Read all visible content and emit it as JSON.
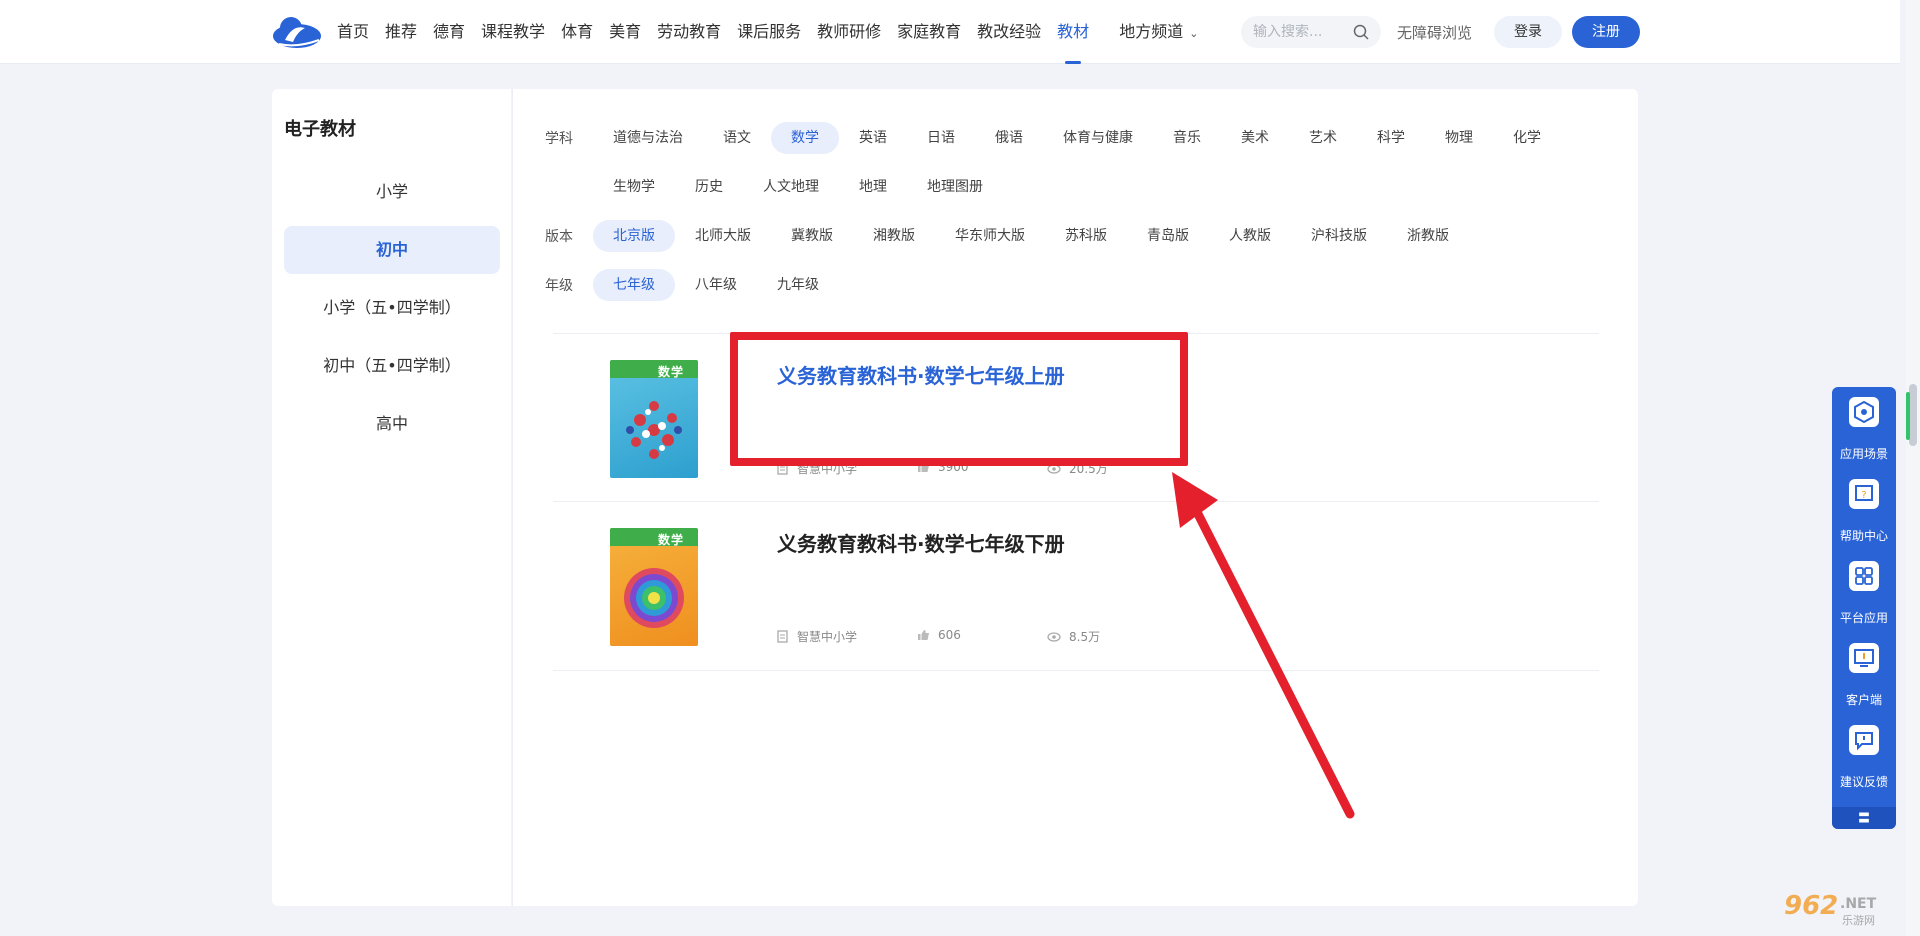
{
  "nav": {
    "items": [
      "首页",
      "推荐",
      "德育",
      "课程教学",
      "体育",
      "美育",
      "劳动教育",
      "课后服务",
      "教师研修",
      "家庭教育",
      "教改经验",
      "教材",
      "地方频道"
    ],
    "active_index": 11,
    "search_placeholder": "输入搜索...",
    "accessible_label": "无障碍浏览",
    "login_label": "登录",
    "register_label": "注册",
    "accent": "#2a63d6"
  },
  "sidebar": {
    "title": "电子教材",
    "items": [
      "小学",
      "初中",
      "小学（五•四学制）",
      "初中（五•四学制）",
      "高中"
    ],
    "active_index": 1
  },
  "filters": {
    "subject": {
      "label": "学科",
      "row1": [
        "道德与法治",
        "语文",
        "数学",
        "英语",
        "日语",
        "俄语",
        "体育与健康",
        "音乐",
        "美术",
        "艺术",
        "科学",
        "物理",
        "化学"
      ],
      "row2": [
        "生物学",
        "历史",
        "人文地理",
        "地理",
        "地理图册"
      ],
      "active": "数学"
    },
    "edition": {
      "label": "版本",
      "items": [
        "北京版",
        "北师大版",
        "冀教版",
        "湘教版",
        "华东师大版",
        "苏科版",
        "青岛版",
        "人教版",
        "沪科技版",
        "浙教版"
      ],
      "active": "北京版"
    },
    "grade": {
      "label": "年级",
      "items": [
        "七年级",
        "八年级",
        "九年级"
      ],
      "active": "七年级"
    }
  },
  "books": [
    {
      "title": "义务教育教科书·数学七年级上册",
      "cover_label": "数学",
      "publisher": "智慧中小学",
      "likes": "3900",
      "views": "20.5万"
    },
    {
      "title": "义务教育教科书·数学七年级下册",
      "cover_label": "数学",
      "publisher": "智慧中小学",
      "likes": "606",
      "views": "8.5万"
    }
  ],
  "tools": {
    "items": [
      "应用场景",
      "帮助中心",
      "平台应用",
      "客户端",
      "建议反馈"
    ],
    "icons": [
      "scene-icon",
      "help-icon",
      "apps-icon",
      "client-icon",
      "feedback-icon"
    ],
    "footer": "〓"
  },
  "watermark": "962.NET 乐游网",
  "annotation_color": "#e3202c"
}
